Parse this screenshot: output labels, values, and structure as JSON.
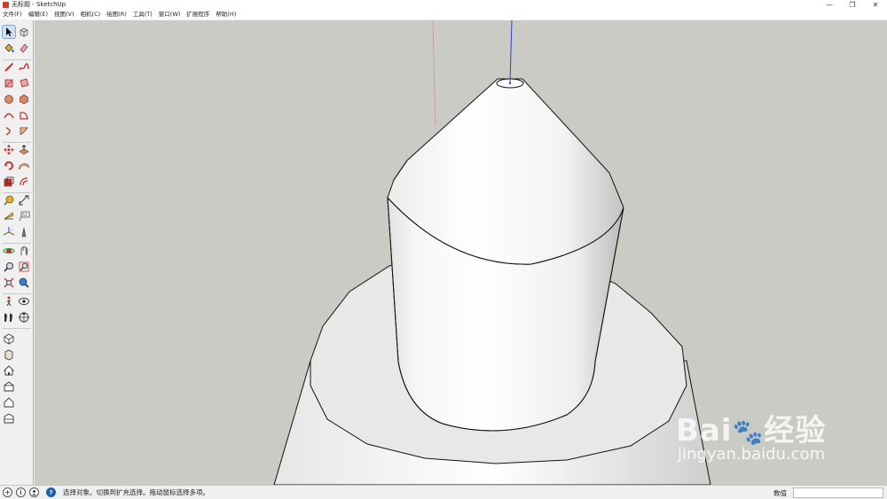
{
  "window": {
    "title": "无标题 - SketchUp",
    "minimize_glyph": "—",
    "restore_glyph": "❐",
    "close_glyph": "✕"
  },
  "menu": [
    "文件(F)",
    "编辑(E)",
    "视图(V)",
    "相机(C)",
    "绘图(R)",
    "工具(T)",
    "窗口(W)",
    "扩展程序",
    "帮助(H)"
  ],
  "toolbar": {
    "tools": [
      "select-icon",
      "component-icon",
      "paint-bucket-icon",
      "eraser-icon",
      "pencil-line-icon",
      "freehand-icon",
      "rectangle-icon",
      "rotated-rectangle-icon",
      "circle-icon",
      "polygon-icon",
      "arc-icon",
      "pie-icon",
      "two-point-arc-icon",
      "three-point-arc-icon",
      "move-icon",
      "push-pull-icon",
      "rotate-icon",
      "follow-me-icon",
      "scale-icon",
      "offset-icon",
      "tape-measure-icon",
      "dimension-icon",
      "protractor-icon",
      "text-icon",
      "axes-icon",
      "3d-text-icon",
      "orbit-icon",
      "pan-icon",
      "zoom-icon",
      "zoom-window-icon",
      "zoom-extents-icon",
      "position-camera-icon",
      "walk-icon",
      "look-around-icon",
      "section-plane-icon",
      "section-display-icon",
      "iso-view-icon",
      "top-view-icon",
      "front-view-icon",
      "right-view-icon",
      "back-view-icon",
      "left-view-icon"
    ]
  },
  "status": {
    "message": "选择对象。切换到扩充选择。拖动鼠标选择多项。",
    "measure_label": "数值",
    "measure_value": "",
    "icons": [
      "geo-location-icon",
      "credits-icon",
      "user-icon",
      "help-icon"
    ],
    "help_glyph": "?",
    "info_glyph": "i"
  },
  "watermark": {
    "logo": "Bai",
    "logo_suffix": "经验",
    "url": "jingyan.baidu.com"
  },
  "colors": {
    "viewport_bg": "#cbcbc6",
    "model_face": "#ffffff",
    "model_edge": "#111111",
    "axis_blue": "#2a3fd6",
    "axis_red": "#c48a8a",
    "icon_red": "#c8322a"
  }
}
